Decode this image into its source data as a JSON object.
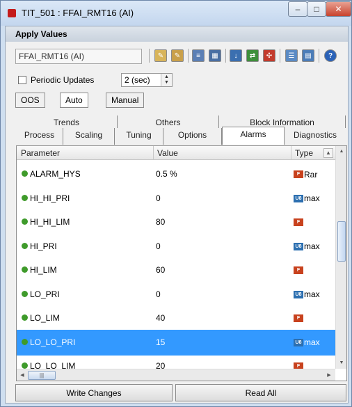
{
  "window": {
    "title": "TIT_501 : FFAI_RMT16 (AI)",
    "minimize_glyph": "–",
    "maximize_glyph": "□",
    "close_glyph": "✕"
  },
  "section": {
    "title": "Apply Values"
  },
  "toolbar": {
    "block_name": "FFAI_RMT16 (AI)",
    "help_glyph": "?"
  },
  "periodic": {
    "label": "Periodic Updates",
    "interval": "2 (sec)",
    "checked": false
  },
  "modes": [
    {
      "label": "OOS"
    },
    {
      "label": "Auto"
    },
    {
      "label": "Manual"
    }
  ],
  "tabs_row1": [
    {
      "label": "Trends"
    },
    {
      "label": "Others"
    },
    {
      "label": "Block Information"
    }
  ],
  "tabs_row2": [
    {
      "label": "Process"
    },
    {
      "label": "Scaling"
    },
    {
      "label": "Tuning"
    },
    {
      "label": "Options"
    },
    {
      "label": "Alarms"
    },
    {
      "label": "Diagnostics"
    }
  ],
  "active_tab": "Alarms",
  "table": {
    "headers": {
      "parameter": "Parameter",
      "value": "Value",
      "type": "Type"
    },
    "rows": [
      {
        "parameter": "ALARM_HYS",
        "value": "0.5 %",
        "type_label": "Rar",
        "type_icon": "red"
      },
      {
        "parameter": "HI_HI_PRI",
        "value": "0",
        "type_label": "max",
        "type_icon": "blue"
      },
      {
        "parameter": "HI_HI_LIM",
        "value": "80",
        "type_label": "",
        "type_icon": "red"
      },
      {
        "parameter": "HI_PRI",
        "value": "0",
        "type_label": "max",
        "type_icon": "blue"
      },
      {
        "parameter": "HI_LIM",
        "value": "60",
        "type_label": "",
        "type_icon": "red"
      },
      {
        "parameter": "LO_PRI",
        "value": "0",
        "type_label": "max",
        "type_icon": "blue"
      },
      {
        "parameter": "LO_LIM",
        "value": "40",
        "type_label": "",
        "type_icon": "red"
      },
      {
        "parameter": "LO_LO_PRI",
        "value": "15",
        "type_label": "max",
        "type_icon": "blue",
        "selected": true
      },
      {
        "parameter": "LO_LO_LIM",
        "value": "20",
        "type_label": "",
        "type_icon": "red"
      }
    ]
  },
  "buttons": {
    "write_changes": "Write Changes",
    "read_all": "Read All"
  },
  "colors": {
    "selection": "#3399ff",
    "status_dot": "#3f9b2b",
    "close_button": "#c8432e"
  }
}
